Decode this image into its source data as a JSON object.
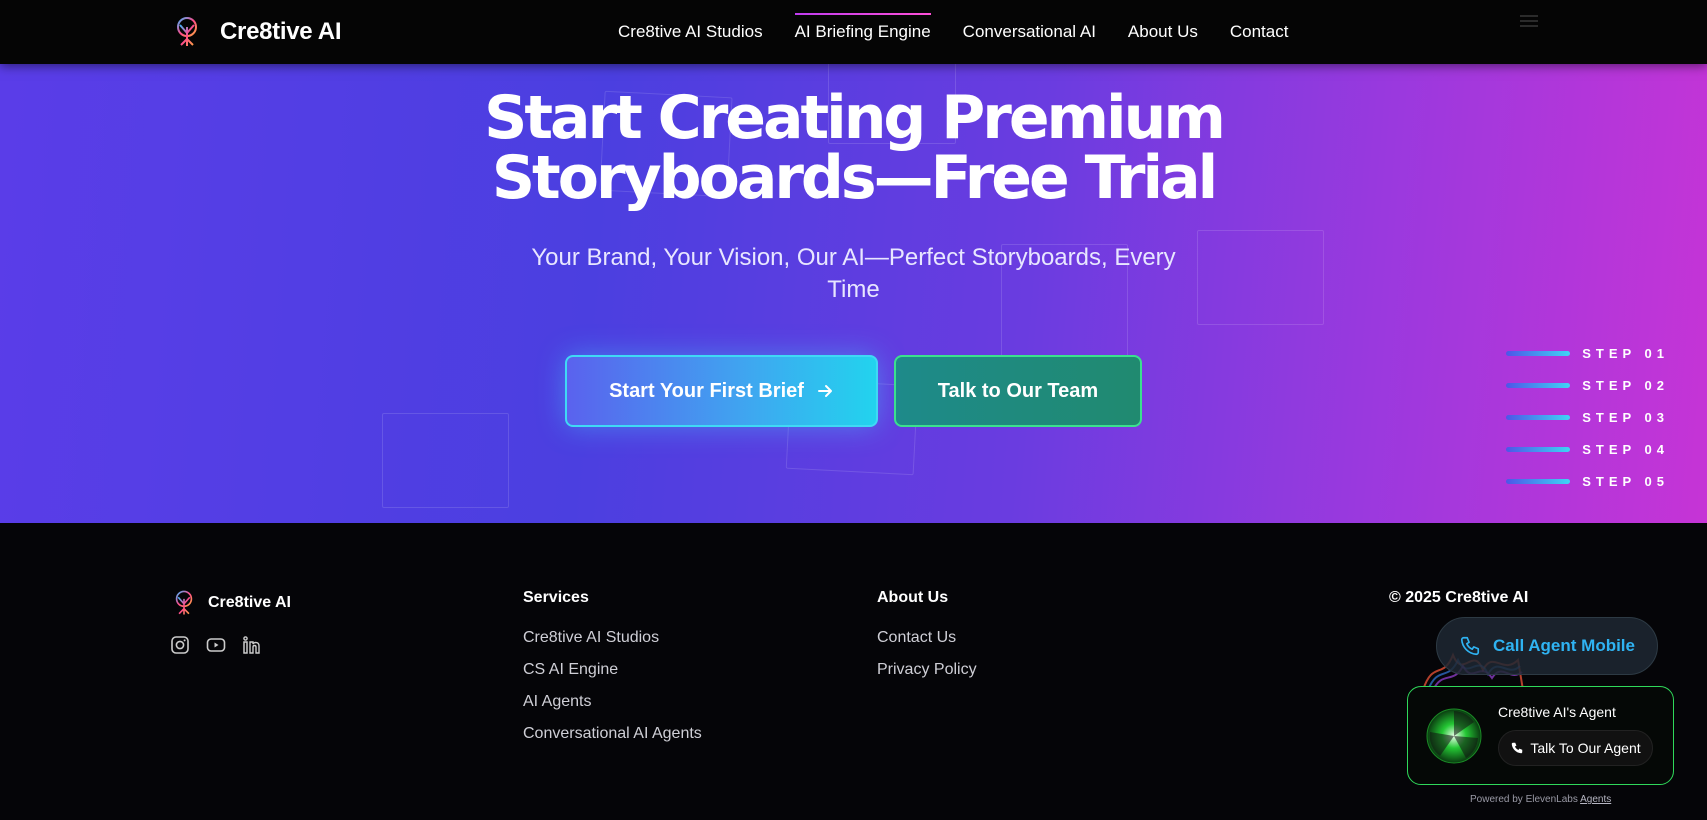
{
  "header": {
    "brand_name": "Cre8tive AI",
    "nav": [
      {
        "label": "Cre8tive AI Studios"
      },
      {
        "label": "AI Briefing Engine",
        "active": true
      },
      {
        "label": "Conversational AI"
      },
      {
        "label": "About Us"
      },
      {
        "label": "Contact"
      }
    ]
  },
  "hero": {
    "title_line1": "Start Creating Premium",
    "title_line2": "Storyboards—Free Trial",
    "subtitle": "Your Brand, Your Vision, Our AI—Perfect Storyboards, Every Time",
    "primary_button": "Start Your First Brief",
    "secondary_button": "Talk to Our Team",
    "steps": [
      "STEP 01",
      "STEP 02",
      "STEP 03",
      "STEP 04",
      "STEP 05"
    ]
  },
  "footer": {
    "brand_name": "Cre8tive AI",
    "socials": [
      "instagram-icon",
      "youtube-icon",
      "linkedin-icon"
    ],
    "services": {
      "heading": "Services",
      "links": [
        "Cre8tive AI Studios",
        "CS AI Engine",
        "AI Agents",
        "Conversational AI Agents"
      ]
    },
    "about": {
      "heading": "About Us",
      "links": [
        "Contact Us",
        "Privacy Policy"
      ]
    },
    "copyright": "© 2025 Cre8tive AI"
  },
  "widget": {
    "call_mobile_label": "Call Agent Mobile",
    "agent_name": "Cre8tive AI's Agent",
    "agent_button": "Talk To Our Agent",
    "powered_by": "Powered by ElevenLabs",
    "powered_link": "Agents"
  },
  "colors": {
    "hero_start": "#5a3de8",
    "hero_end": "#c634d6",
    "accent_cyan": "#22d3ee",
    "accent_green": "#2fd85a",
    "link_blue": "#2fb3f2"
  }
}
